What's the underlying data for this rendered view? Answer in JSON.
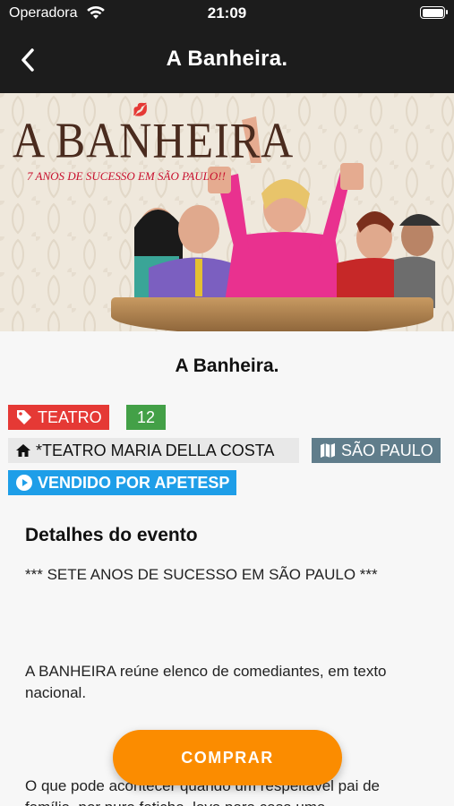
{
  "status_bar": {
    "carrier": "Operadora",
    "time": "21:09"
  },
  "nav": {
    "title": "A Banheira."
  },
  "poster": {
    "title": "A BANHEIRA",
    "subtitle": "7 ANOS DE SUCESSO EM SÃO PAULO!!"
  },
  "event": {
    "title": "A Banheira.",
    "category": "TEATRO",
    "rating": "12",
    "venue": "*TEATRO MARIA DELLA COSTA",
    "city": "SÃO PAULO",
    "seller": "VENDIDO POR APETESP"
  },
  "details": {
    "heading": "Detalhes do evento",
    "p1": "*** SETE ANOS DE SUCESSO EM SÃO PAULO ***",
    "p2": "A BANHEIRA reúne elenco de comediantes, em texto nacional.",
    "p3": "O que pode acontecer quando um respeitável pai de família, por puro fetiche, leva para casa uma"
  },
  "buy_button": {
    "label": "COMPRAR"
  },
  "colors": {
    "bar_bg": "#1c1c1c",
    "category": "#e53935",
    "rating": "#43a047",
    "city": "#607d8b",
    "seller": "#1e9ee8",
    "accent": "#fb8c00"
  },
  "icons": [
    "wifi-icon",
    "battery-icon",
    "back-chevron-icon",
    "tag-icon",
    "home-icon",
    "map-icon",
    "play-circle-icon"
  ]
}
